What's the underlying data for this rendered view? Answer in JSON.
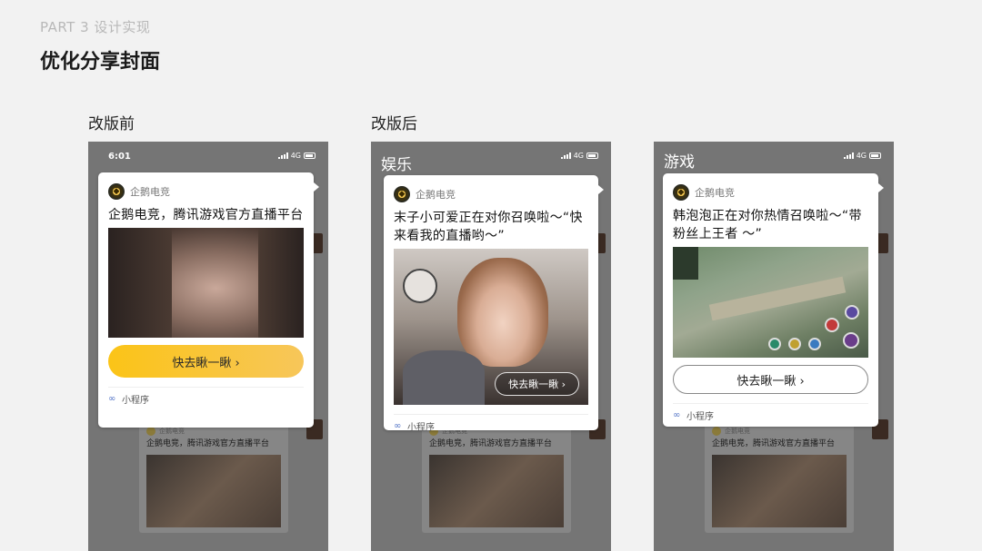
{
  "header": {
    "part": "PART 3 设计实现",
    "title": "优化分享封面"
  },
  "columns": {
    "before": "改版前",
    "after": "改版后"
  },
  "phones": [
    {
      "time": "6:01",
      "network": "4G",
      "category": "",
      "card": {
        "brand": "企鹅电竞",
        "text": "企鹅电竞，腾讯游戏官方直播平台",
        "button": "快去瞅一瞅 ›",
        "mini_program": "小程序"
      }
    },
    {
      "time": "",
      "network": "4G",
      "category": "娱乐",
      "card": {
        "brand": "企鹅电竞",
        "text": "末子小可爱正在对你召唤啦～“快来看我的直播哟～”",
        "button": "快去瞅一瞅 ›",
        "mini_program": "小程序"
      }
    },
    {
      "time": "",
      "network": "4G",
      "category": "游戏",
      "card": {
        "brand": "企鹅电竞",
        "text": "韩泡泡正在对你热情召唤啦～“带粉丝上王者 ～”",
        "button": "快去瞅一瞅 ›",
        "mini_program": "小程序"
      }
    }
  ],
  "background_chat": {
    "brand": "企鹅电竞",
    "text": "企鹅电竞，腾讯游戏官方直播平台"
  },
  "colors": {
    "accent_yellow": "#fbc417",
    "page_bg": "#f2f2f2",
    "phone_overlay": "#757575"
  }
}
